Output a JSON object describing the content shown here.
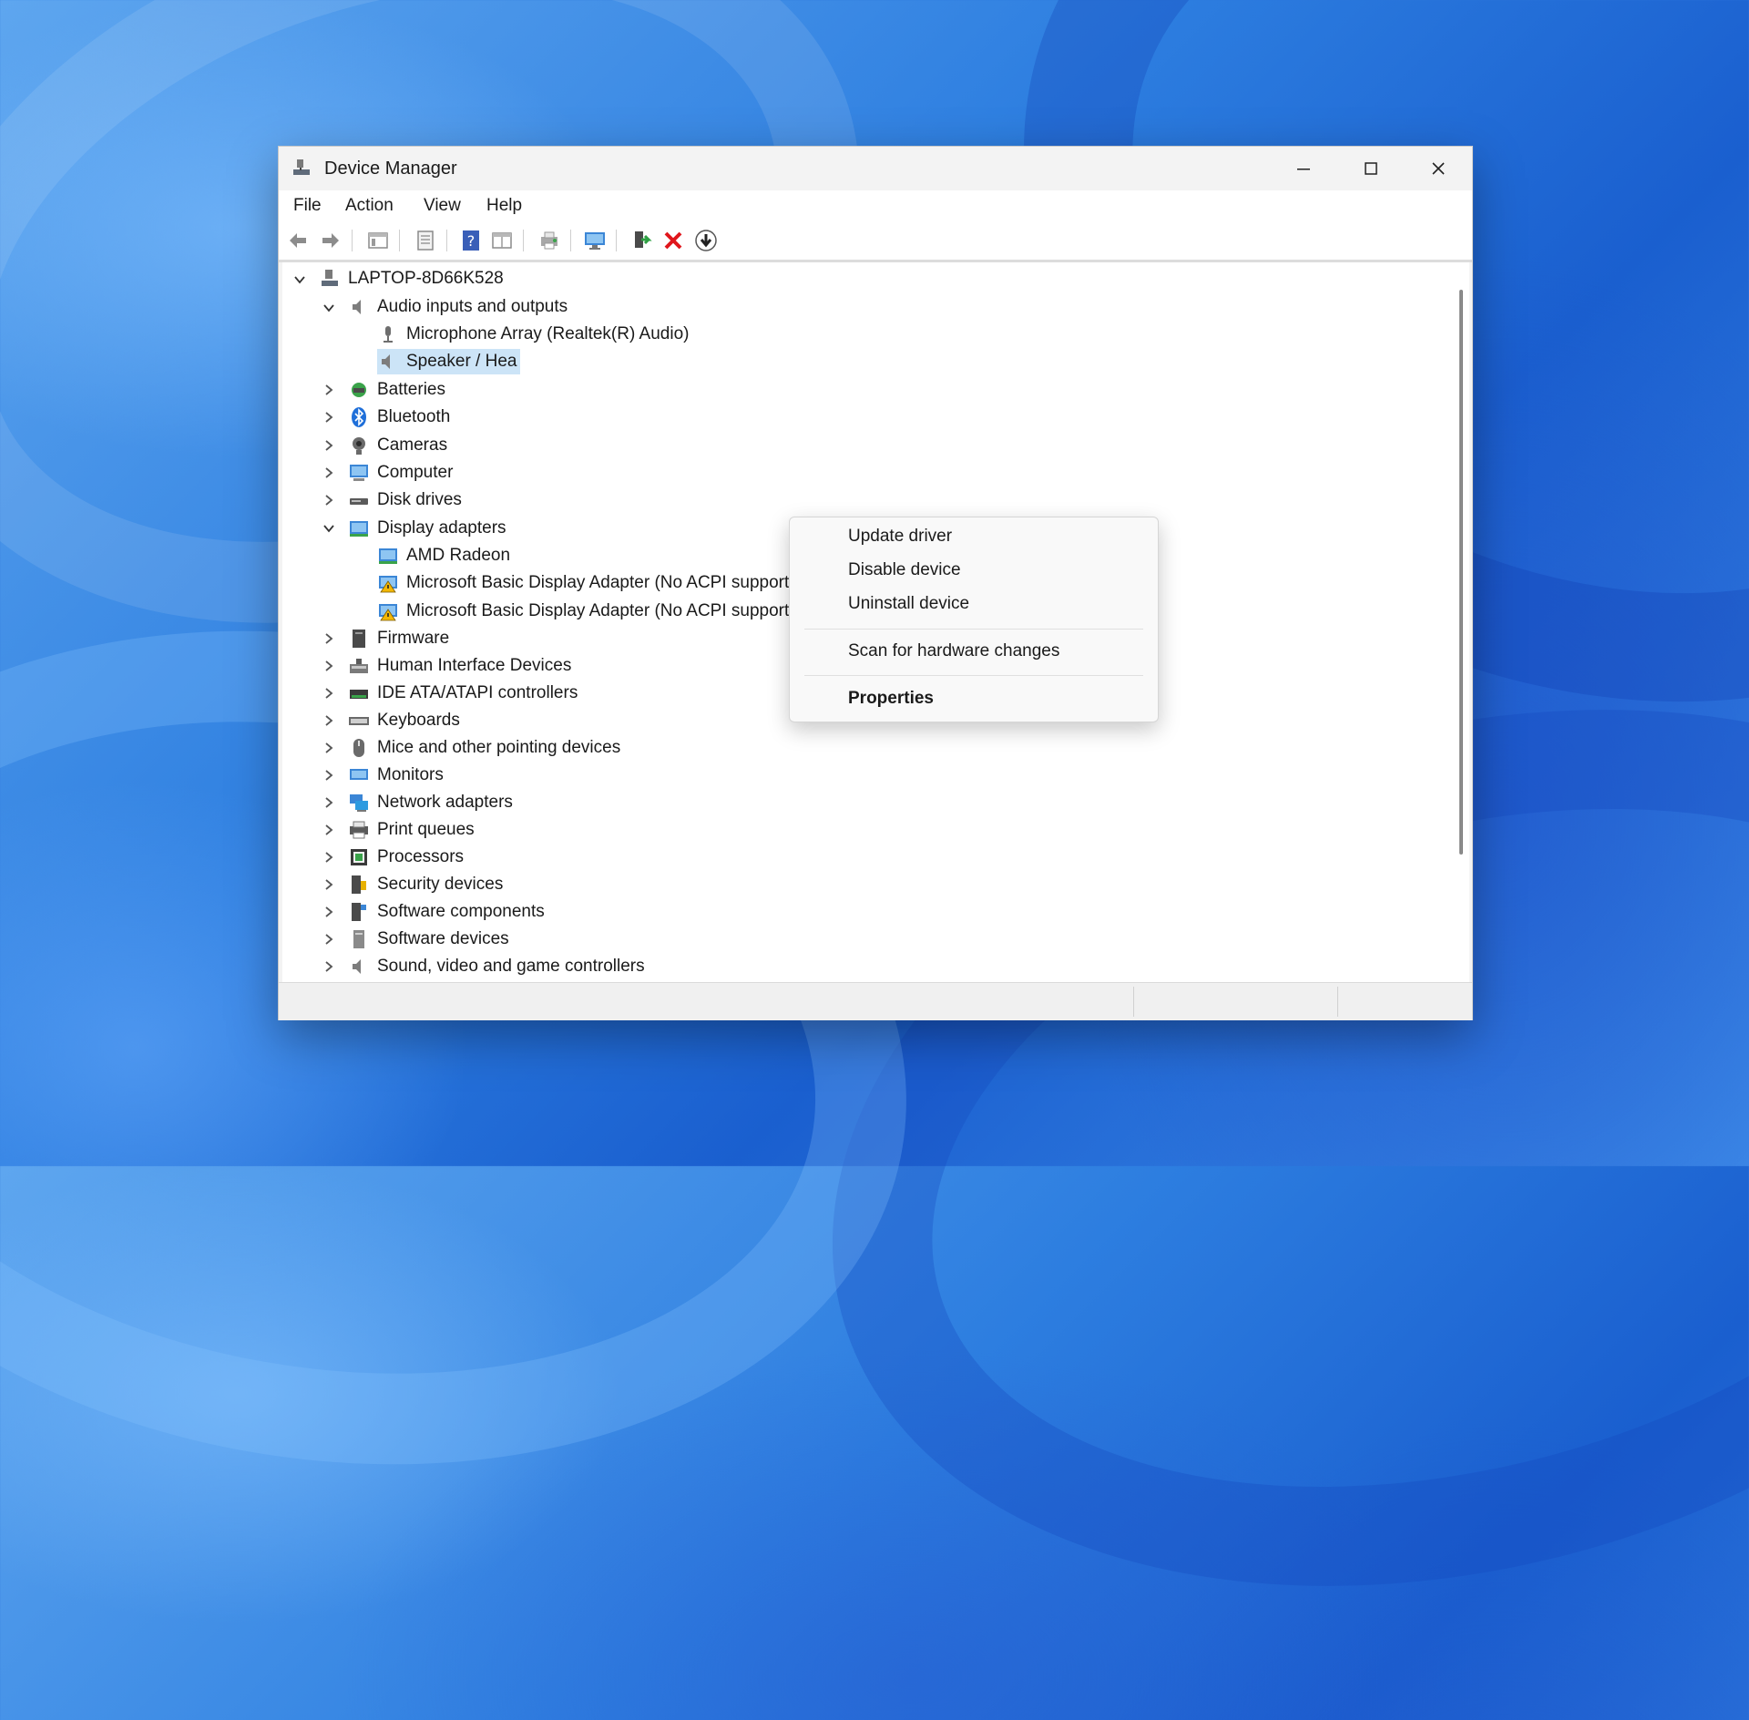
{
  "window": {
    "title": "Device Manager",
    "minimize_icon": "minimize-icon",
    "maximize_icon": "maximize-icon",
    "close_icon": "close-icon"
  },
  "menu": [
    "File",
    "Action",
    "View",
    "Help"
  ],
  "toolbar": {
    "icons": [
      "back-arrow-icon",
      "forward-arrow-icon",
      "console-tree-icon",
      "properties-sheet-icon",
      "help-icon",
      "view-icon",
      "print-icon",
      "monitor-icon",
      "update-driver-icon",
      "uninstall-icon",
      "download-icon"
    ]
  },
  "tree": {
    "root": "LAPTOP-8D66K528",
    "audio": {
      "label": "Audio inputs and outputs",
      "children": [
        "Microphone Array (Realtek(R) Audio)",
        "Speaker / Hea"
      ]
    },
    "categories_a": [
      "Batteries",
      "Bluetooth",
      "Cameras",
      "Computer",
      "Disk drives"
    ],
    "display": {
      "label": "Display adapters",
      "children": [
        "AMD Radeon",
        "Microsoft Basic Display Adapter (No ACPI support)",
        "Microsoft Basic Display Adapter (No ACPI support)"
      ]
    },
    "categories_b": [
      "Firmware",
      "Human Interface Devices",
      "IDE ATA/ATAPI controllers",
      "Keyboards",
      "Mice and other pointing devices",
      "Monitors",
      "Network adapters",
      "Print queues",
      "Processors",
      "Security devices",
      "Software components",
      "Software devices",
      "Sound, video and game controllers"
    ]
  },
  "context_menu": {
    "items": [
      "Update driver",
      "Disable device",
      "Uninstall device"
    ],
    "scan": "Scan for hardware changes",
    "properties": "Properties"
  },
  "colors": {
    "selection": "#cce4f7",
    "desktop_accent": "#2d7ee0",
    "uninstall_red": "#e0161c"
  }
}
